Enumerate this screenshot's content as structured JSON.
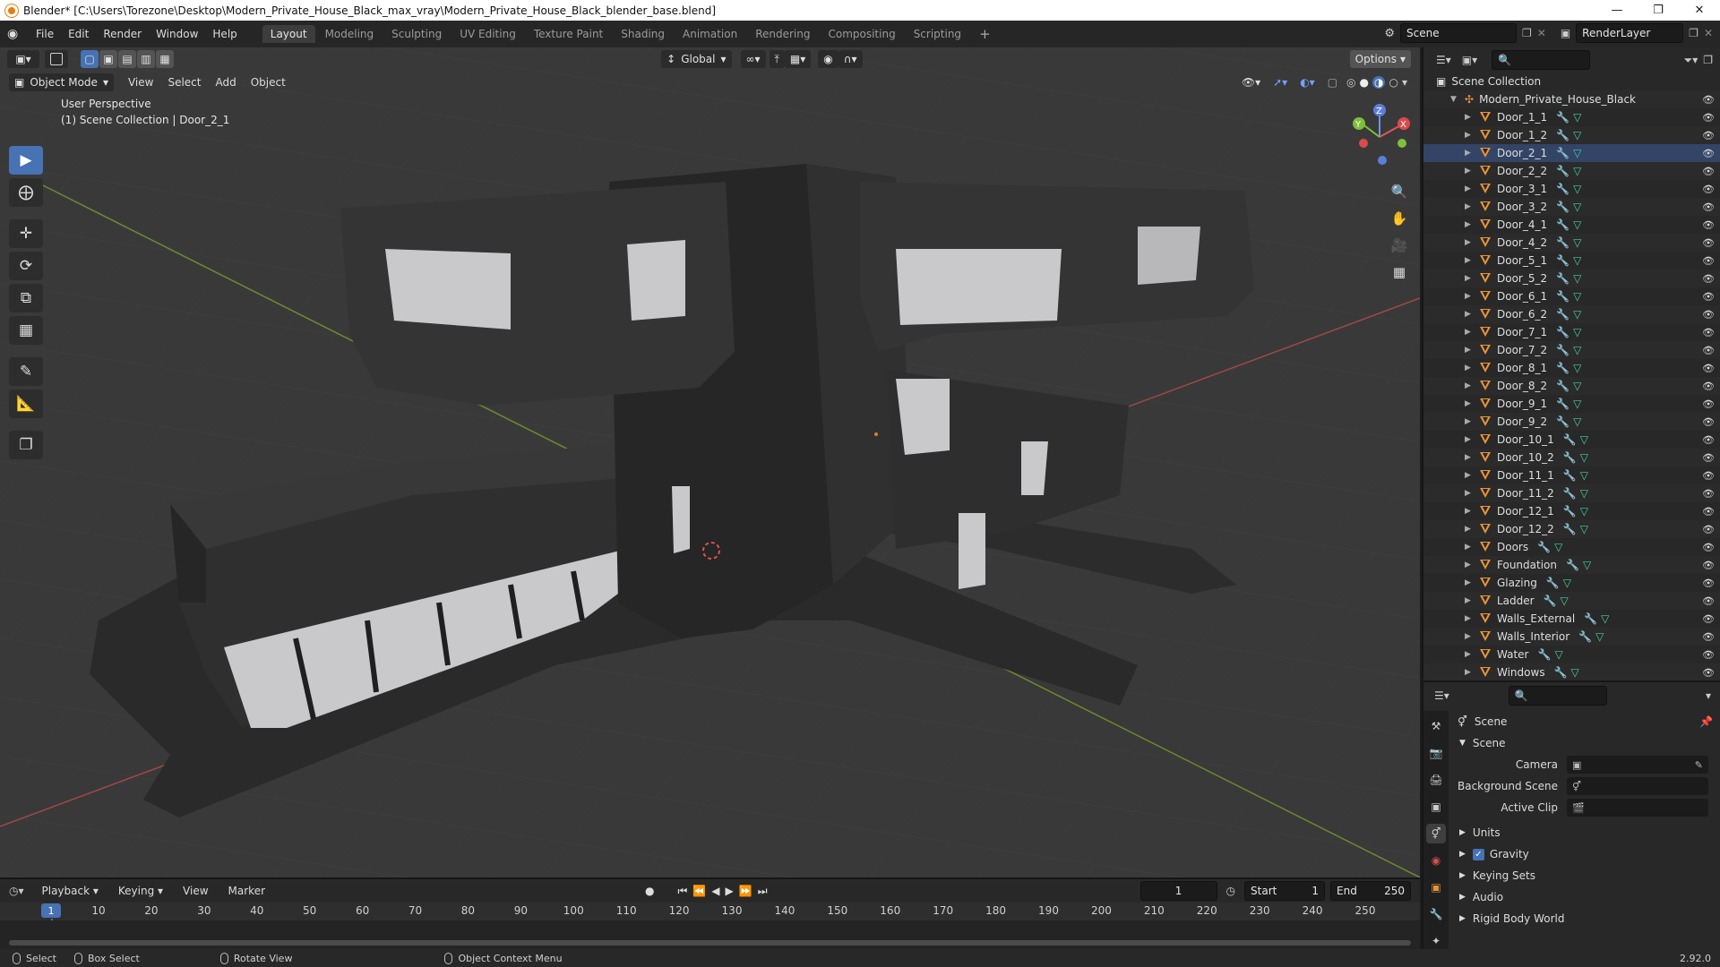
{
  "window": {
    "title": "Blender* [C:\\Users\\Torezone\\Desktop\\Modern_Private_House_Black_max_vray\\Modern_Private_House_Black_blender_base.blend]"
  },
  "menu": [
    "File",
    "Edit",
    "Render",
    "Window",
    "Help"
  ],
  "workspaces": [
    "Layout",
    "Modeling",
    "Sculpting",
    "UV Editing",
    "Texture Paint",
    "Shading",
    "Animation",
    "Rendering",
    "Compositing",
    "Scripting"
  ],
  "active_workspace": "Layout",
  "scene_name": "Scene",
  "render_layer": "RenderLayer",
  "viewport": {
    "mode": "Object Mode",
    "menus": [
      "View",
      "Select",
      "Add",
      "Object"
    ],
    "orientation": "Global",
    "options_label": "Options",
    "overlay_line1": "User Perspective",
    "overlay_line2": "(1) Scene Collection | Door_2_1"
  },
  "outliner": {
    "root": "Scene Collection",
    "collection": "Modern_Private_House_Black",
    "objects": [
      "Door_1_1",
      "Door_1_2",
      "Door_2_1",
      "Door_2_2",
      "Door_3_1",
      "Door_3_2",
      "Door_4_1",
      "Door_4_2",
      "Door_5_1",
      "Door_5_2",
      "Door_6_1",
      "Door_6_2",
      "Door_7_1",
      "Door_7_2",
      "Door_8_1",
      "Door_8_2",
      "Door_9_1",
      "Door_9_2",
      "Door_10_1",
      "Door_10_2",
      "Door_11_1",
      "Door_11_2",
      "Door_12_1",
      "Door_12_2",
      "Doors",
      "Foundation",
      "Glazing",
      "Ladder",
      "Walls_External",
      "Walls_Interior",
      "Water",
      "Windows"
    ]
  },
  "properties": {
    "context": "Scene",
    "panel": "Scene",
    "camera_label": "Camera",
    "background_label": "Background Scene",
    "clip_label": "Active Clip",
    "sections": [
      "Units",
      "Gravity",
      "Keying Sets",
      "Audio",
      "Rigid Body World"
    ]
  },
  "timeline": {
    "menus": [
      "Playback",
      "Keying",
      "View",
      "Marker"
    ],
    "current_frame": "1",
    "start_label": "Start",
    "start": "1",
    "end_label": "End",
    "end": "250",
    "ticks": [
      "1",
      "10",
      "20",
      "30",
      "40",
      "50",
      "60",
      "70",
      "80",
      "90",
      "100",
      "110",
      "120",
      "130",
      "140",
      "150",
      "160",
      "170",
      "180",
      "190",
      "200",
      "210",
      "220",
      "230",
      "240",
      "250"
    ]
  },
  "status": {
    "select": "Select",
    "box_select": "Box Select",
    "rotate": "Rotate View",
    "context_menu": "Object Context Menu",
    "version": "2.92.0"
  },
  "colors": {
    "accent": "#4772b3",
    "object_orange": "#e8933a",
    "mesh_green": "#46d09c"
  }
}
